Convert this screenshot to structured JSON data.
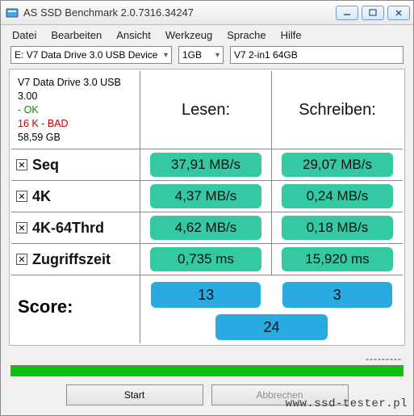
{
  "window": {
    "title": "AS SSD Benchmark 2.0.7316.34247"
  },
  "menu": {
    "file": "Datei",
    "edit": "Bearbeiten",
    "view": "Ansicht",
    "tools": "Werkzeug",
    "lang": "Sprache",
    "help": "Hilfe"
  },
  "toolbar": {
    "drive": "E: V7 Data Drive 3.0 USB Device",
    "size": "1GB",
    "name_field": "V7 2-in1 64GB"
  },
  "info": {
    "device": "V7 Data Drive 3.0 USB",
    "version": "3.00",
    "ok": " - OK",
    "bad": "16 K - BAD",
    "capacity": "58,59 GB"
  },
  "headers": {
    "read": "Lesen:",
    "write": "Schreiben:"
  },
  "tests": {
    "seq": {
      "label": "Seq",
      "checked": true,
      "read": "37,91 MB/s",
      "write": "29,07 MB/s"
    },
    "k4": {
      "label": "4K",
      "checked": true,
      "read": "4,37 MB/s",
      "write": "0,24 MB/s"
    },
    "k4thr": {
      "label": "4K-64Thrd",
      "checked": true,
      "read": "4,62 MB/s",
      "write": "0,18 MB/s"
    },
    "acc": {
      "label": "Zugriffszeit",
      "checked": true,
      "read": "0,735 ms",
      "write": "15,920 ms"
    }
  },
  "score": {
    "label": "Score:",
    "read": "13",
    "write": "3",
    "total": "24"
  },
  "buttons": {
    "start": "Start",
    "abort": "Abbrechen"
  },
  "watermark": "www.ssd-tester.pl",
  "icons": {
    "app": "app-icon",
    "min": "minimize-icon",
    "max": "maximize-icon",
    "close": "close-icon",
    "caret": "chevron-down-icon",
    "check": "checkmark-icon"
  }
}
